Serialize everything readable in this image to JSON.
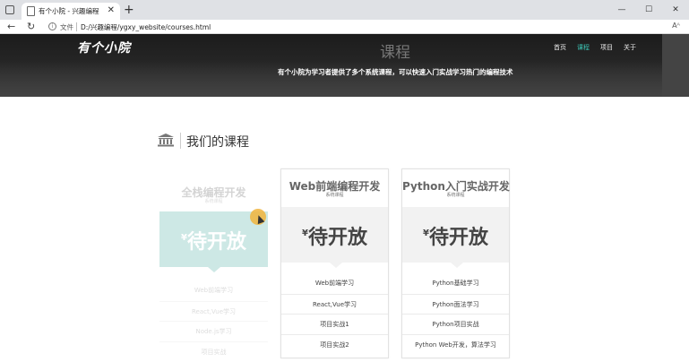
{
  "browser": {
    "tab_title": "有个小院 - 兴趣编程",
    "tab_close": "✕",
    "new_tab": "+",
    "window_controls": [
      "—",
      "☐",
      "✕"
    ],
    "back": "←",
    "refresh": "↻",
    "file_label": "文件",
    "url": "D:/兴趣编程/ygxy_website/courses.html",
    "addr_icons": [
      "Aᴬ",
      "☆"
    ]
  },
  "site": {
    "logo": "有个小院",
    "page_title": "课程",
    "nav": [
      {
        "label": "首页",
        "active": false
      },
      {
        "label": "课程",
        "active": true
      },
      {
        "label": "项目",
        "active": false
      },
      {
        "label": "关于",
        "active": false
      }
    ],
    "subtitle": "有个小院为学习者提供了多个系统课程，可以快速入门实战学习热门的编程技术",
    "accent_color": "#3cc4b4"
  },
  "section": {
    "icon": "bank-icon",
    "title": "我们的课程"
  },
  "courses": [
    {
      "title": "全栈编程开发",
      "subtitle": "系统课程",
      "price_symbol": "¥",
      "price": "待开放",
      "items": [
        "Web前端学习",
        "React,Vue学习",
        "Node.js学习",
        "项目实战"
      ]
    },
    {
      "title": "Web前端编程开发",
      "subtitle": "系统课程",
      "price_symbol": "¥",
      "price": "待开放",
      "items": [
        "Web前端学习",
        "React,Vue学习",
        "项目实战1",
        "项目实战2"
      ]
    },
    {
      "title": "Python入门实战开发",
      "subtitle": "系统课程",
      "price_symbol": "¥",
      "price": "待开放",
      "items": [
        "Python基础学习",
        "Python面法学习",
        "Python项目实战",
        "Python Web开发，算法学习"
      ]
    }
  ]
}
